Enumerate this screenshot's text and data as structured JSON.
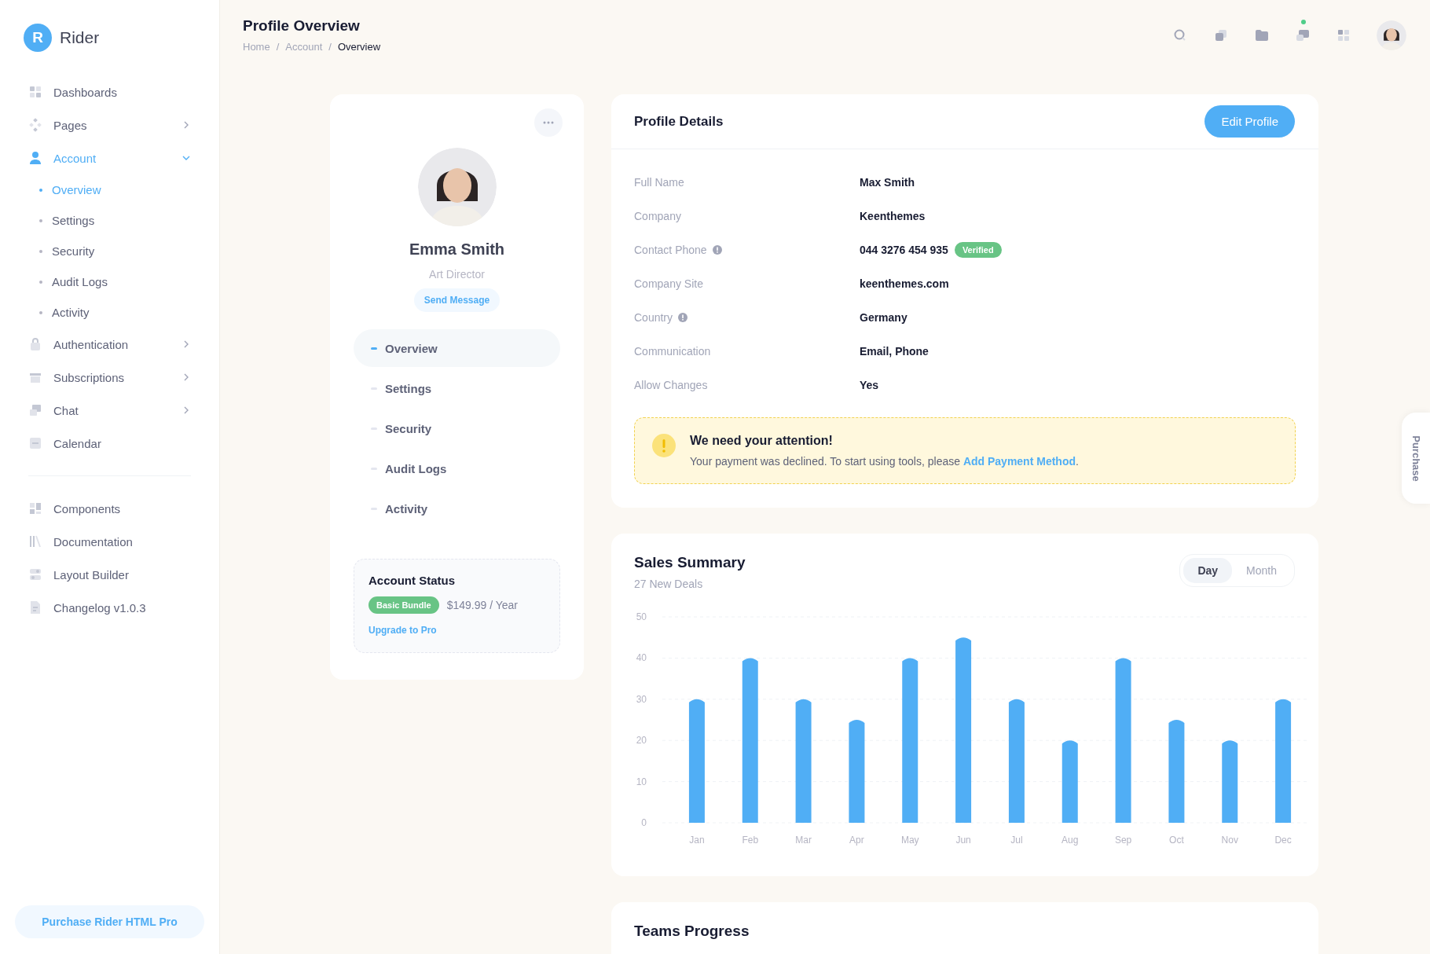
{
  "sidebar": {
    "logo": {
      "letter": "R",
      "name": "Rider"
    },
    "items": [
      {
        "label": "Dashboards",
        "kind": "link"
      },
      {
        "label": "Pages",
        "kind": "menu",
        "expanded": false
      },
      {
        "label": "Account",
        "kind": "menu",
        "expanded": true,
        "selected": true,
        "children": [
          {
            "label": "Overview",
            "selected": true
          },
          {
            "label": "Settings",
            "selected": false
          },
          {
            "label": "Security",
            "selected": false
          },
          {
            "label": "Audit Logs",
            "selected": false
          },
          {
            "label": "Activity",
            "selected": false
          }
        ]
      },
      {
        "label": "Authentication",
        "kind": "menu",
        "expanded": false
      },
      {
        "label": "Subscriptions",
        "kind": "menu",
        "expanded": false
      },
      {
        "label": "Chat",
        "kind": "menu",
        "expanded": false
      },
      {
        "label": "Calendar",
        "kind": "link"
      }
    ],
    "secondary_items": [
      {
        "label": "Components"
      },
      {
        "label": "Documentation"
      },
      {
        "label": "Layout Builder"
      },
      {
        "label": "Changelog v1.0.3"
      }
    ],
    "purchase_button": "Purchase Rider HTML Pro"
  },
  "header": {
    "title": "Profile Overview",
    "breadcrumb": [
      "Home",
      "Account",
      "Overview"
    ],
    "breadcrumb_separator": "/",
    "icons": [
      {
        "kind": "search",
        "badge": false
      },
      {
        "kind": "copy",
        "badge": false
      },
      {
        "kind": "folder",
        "badge": false
      },
      {
        "kind": "chat",
        "badge": true
      },
      {
        "kind": "grid",
        "badge": false
      },
      {
        "kind": "avatar"
      }
    ]
  },
  "profile_card": {
    "name": "Emma Smith",
    "role": "Art Director",
    "message_button": "Send Message",
    "nav": [
      {
        "label": "Overview",
        "selected": true
      },
      {
        "label": "Settings",
        "selected": false
      },
      {
        "label": "Security",
        "selected": false
      },
      {
        "label": "Audit Logs",
        "selected": false
      },
      {
        "label": "Activity",
        "selected": false
      }
    ],
    "account_status": {
      "title": "Account Status",
      "plan": "Basic Bundle",
      "price": "$149.99 / Year",
      "upgrade_link": "Upgrade to Pro"
    }
  },
  "profile_details": {
    "title": "Profile Details",
    "edit_button": "Edit Profile",
    "rows": [
      {
        "label": "Full Name",
        "value": "Max Smith",
        "info": false
      },
      {
        "label": "Company",
        "value": "Keenthemes",
        "info": false
      },
      {
        "label": "Contact Phone",
        "value": "044 3276 454 935",
        "info": true,
        "badge": "Verified"
      },
      {
        "label": "Company Site",
        "value": "keenthemes.com",
        "info": false
      },
      {
        "label": "Country",
        "value": "Germany",
        "info": true
      },
      {
        "label": "Communication",
        "value": "Email, Phone",
        "info": false
      },
      {
        "label": "Allow Changes",
        "value": "Yes",
        "info": false
      }
    ],
    "alert": {
      "title": "We need your attention!",
      "text": "Your payment was declined. To start using tools, please",
      "link": "Add Payment Method",
      "end": "."
    }
  },
  "sales_summary": {
    "title": "Sales Summary",
    "subtitle": "27 New Deals",
    "toggle": [
      {
        "label": "Day",
        "selected": true
      },
      {
        "label": "Month",
        "selected": false
      }
    ],
    "chart_data": {
      "type": "bar",
      "categories": [
        "Jan",
        "Feb",
        "Mar",
        "Apr",
        "May",
        "Jun",
        "Jul",
        "Aug",
        "Sep",
        "Oct",
        "Nov",
        "Dec"
      ],
      "series": [
        {
          "color": "#50aef5",
          "values": [
            30,
            40,
            30,
            25,
            40,
            45,
            30,
            20,
            40,
            25,
            20,
            30
          ]
        }
      ],
      "ylim": [
        0,
        50
      ],
      "yticks": [
        0,
        10,
        20,
        30,
        40,
        50
      ],
      "grid": true
    }
  },
  "teams_progress": {
    "title": "Teams Progress"
  },
  "side_tab": "Purchase"
}
